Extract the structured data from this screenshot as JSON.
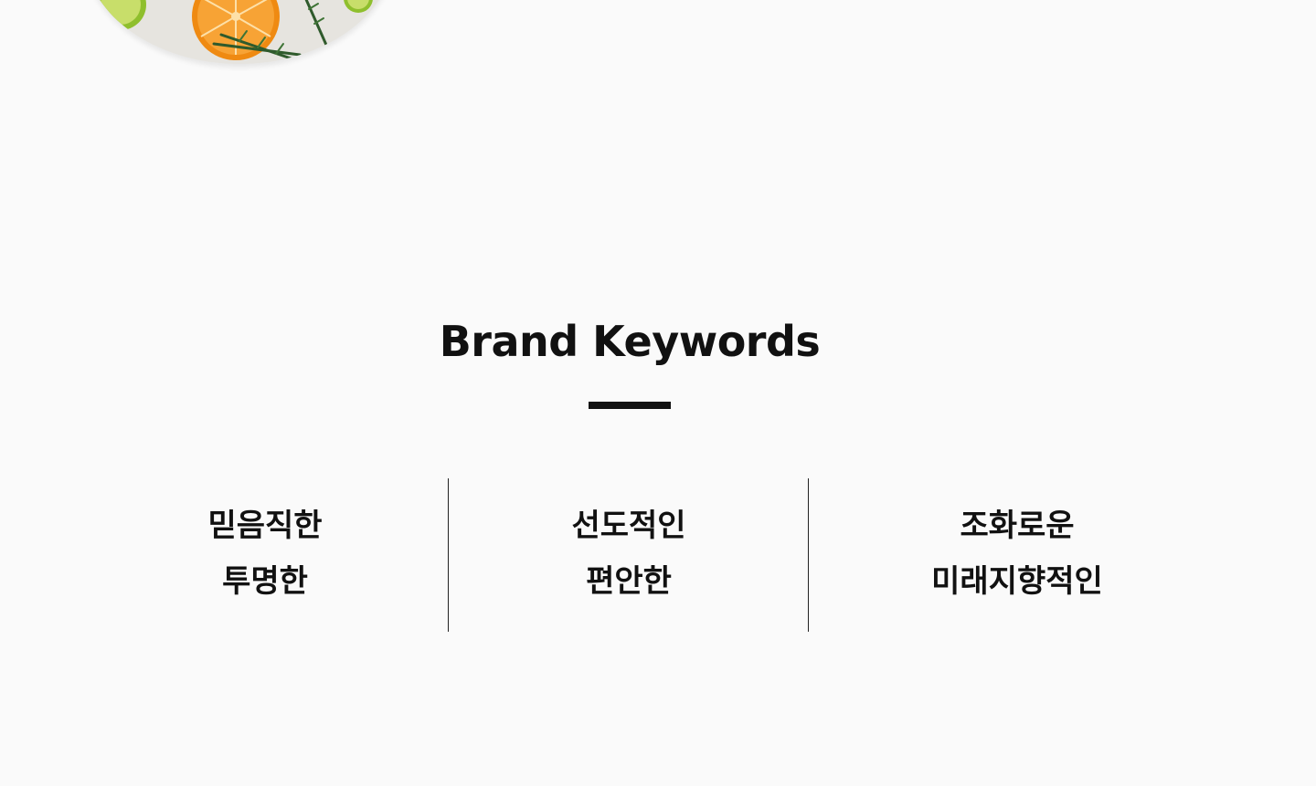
{
  "brand_keywords": {
    "title": "Brand Keywords",
    "columns": [
      {
        "line1": "믿음직한",
        "line2": "투명한"
      },
      {
        "line1": "선도적인",
        "line2": "편안한"
      },
      {
        "line1": "조화로운",
        "line2": "미래지향적인"
      }
    ]
  },
  "hero_image": {
    "icon": "citrus-photo-icon",
    "accent_color": "#f08a13"
  },
  "colors": {
    "background": "#fafafa",
    "text": "#111111",
    "divider": "#222222"
  }
}
